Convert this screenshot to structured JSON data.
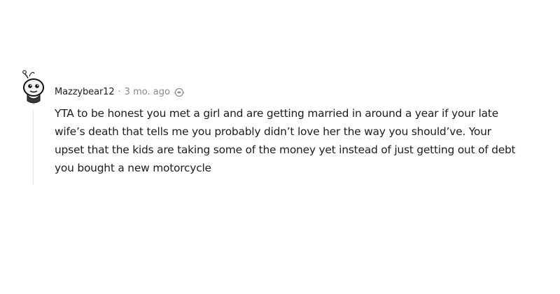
{
  "comment": {
    "author": "Mazzybear12",
    "separator": "·",
    "timestamp": "3 mo. ago",
    "award_icon": "award-icon",
    "avatar_icon": "snoo-avatar-icon",
    "body": "YTA to be honest you met a girl and are getting married in around a year if your late wife’s death that tells me you probably didn’t love her the way you should’ve. Your upset that the kids are taking some of the money yet instead of just getting out of debt you bought a new motorcycle"
  },
  "colors": {
    "text": "#1c1c1c",
    "meta": "#878a8c",
    "thread_line": "#e6e6e6",
    "background": "#ffffff"
  }
}
